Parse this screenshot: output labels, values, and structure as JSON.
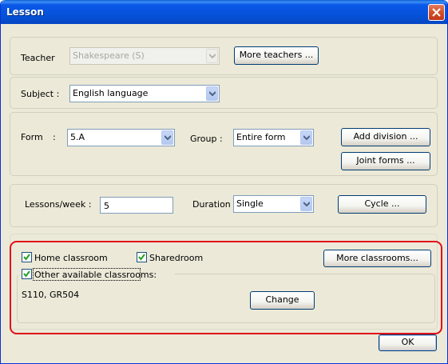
{
  "window": {
    "title": "Lesson"
  },
  "teacher": {
    "label": "Teacher",
    "value": "Shakespeare (S)",
    "more_button": "More teachers ..."
  },
  "subject": {
    "label": "Subject :",
    "value": "English language"
  },
  "form": {
    "label": "Form",
    "colon": ":",
    "value": "5.A",
    "group_label": "Group :",
    "group_value": "Entire form",
    "add_division_button": "Add division ...",
    "joint_forms_button": "Joint forms ..."
  },
  "lessons": {
    "per_week_label": "Lessons/week :",
    "per_week_value": "5",
    "duration_label": "Duration",
    "duration_value": "Single",
    "cycle_button": "Cycle ..."
  },
  "classrooms": {
    "home_label": "Home classroom",
    "home_checked": true,
    "shared_label": "Sharedroom",
    "shared_checked": true,
    "other_label": "Other available classrooms:",
    "other_checked": true,
    "list_value": "S110, GR504",
    "change_button": "Change",
    "more_button": "More classrooms..."
  },
  "ok_button": "OK",
  "colors": {
    "highlight_outline": "#e0101a",
    "title_bar": "#0553da",
    "face": "#ece9d8"
  }
}
